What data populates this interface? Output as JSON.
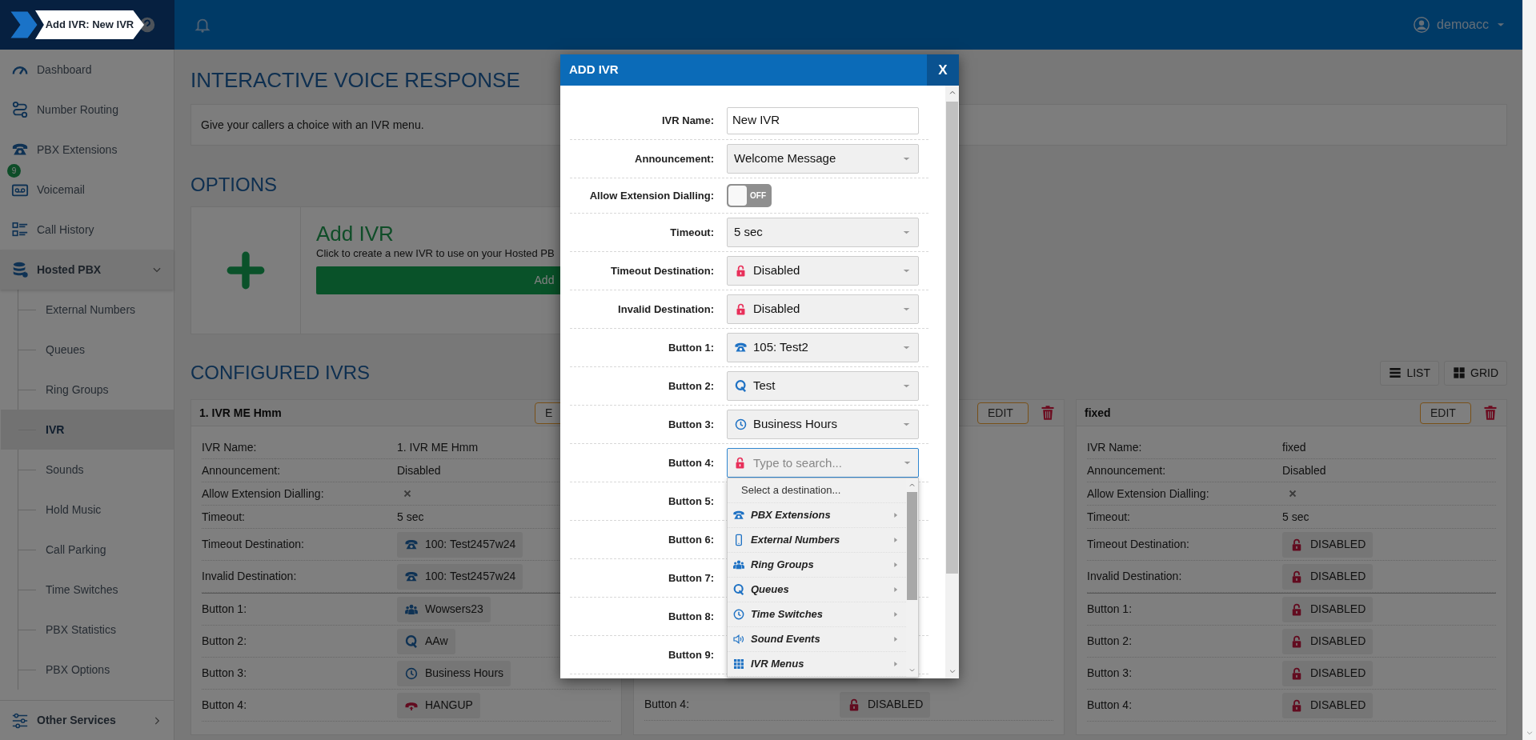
{
  "header": {
    "breadcrumb": "Add IVR: New IVR",
    "user": "demoacc"
  },
  "sidebar": {
    "items": [
      {
        "label": "Dashboard",
        "selected": false
      },
      {
        "label": "Number Routing",
        "selected": false
      },
      {
        "label": "PBX Extensions",
        "selected": false
      },
      {
        "label": "Voicemail",
        "selected": false,
        "badge": "9"
      },
      {
        "label": "Call History",
        "selected": false
      },
      {
        "label": "Hosted PBX",
        "selected": false,
        "expanded": true,
        "children": [
          {
            "label": "External Numbers",
            "selected": false
          },
          {
            "label": "Queues",
            "selected": false
          },
          {
            "label": "Ring Groups",
            "selected": false
          },
          {
            "label": "IVR",
            "selected": true
          },
          {
            "label": "Sounds",
            "selected": false
          },
          {
            "label": "Hold Music",
            "selected": false
          },
          {
            "label": "Call Parking",
            "selected": false
          },
          {
            "label": "Time Switches",
            "selected": false
          },
          {
            "label": "PBX Statistics",
            "selected": false
          },
          {
            "label": "PBX Options",
            "selected": false
          }
        ]
      },
      {
        "label": "Other Services",
        "selected": false,
        "expanded": false
      }
    ]
  },
  "page": {
    "title": "INTERACTIVE VOICE RESPONSE",
    "intro": "Give your callers a choice with an IVR menu.",
    "options_heading": "OPTIONS",
    "option": {
      "title": "Add IVR",
      "description": "Click to create a new IVR to use on your Hosted PB",
      "button": "Add"
    },
    "configured_heading": "CONFIGURED IVRS",
    "view_buttons": [
      "LIST",
      "GRID"
    ]
  },
  "cards": [
    {
      "title": "1. IVR ME Hmm",
      "edit": "E",
      "details": [
        {
          "label": "IVR Name:",
          "kind": "text",
          "value": "1. IVR ME Hmm"
        },
        {
          "label": "Announcement:",
          "kind": "text",
          "value": "Disabled"
        },
        {
          "label": "Allow Extension Dialling:",
          "kind": "bool",
          "checked": false
        },
        {
          "label": "Timeout:",
          "kind": "text",
          "value": "5 sec"
        },
        {
          "label": "Timeout Destination:",
          "kind": "extension",
          "value": "100: Test2457w24"
        },
        {
          "label": "Invalid Destination:",
          "kind": "extension",
          "value": "100: Test2457w24"
        }
      ],
      "buttons": [
        {
          "label": "Button 1:",
          "kind": "ring_group",
          "value": "Wowsers23"
        },
        {
          "label": "Button 2:",
          "kind": "queue",
          "value": "AAw"
        },
        {
          "label": "Button 3:",
          "kind": "time_switch",
          "value": "Business Hours"
        },
        {
          "label": "Button 4:",
          "kind": "hangup",
          "value": "HANGUP"
        }
      ]
    },
    {
      "edit": "EDIT",
      "buttons": [
        {
          "label": "Button 4:",
          "kind": "disabled",
          "value": "DISABLED"
        }
      ]
    },
    {
      "title": "fixed",
      "edit": "EDIT",
      "details": [
        {
          "label": "IVR Name:",
          "kind": "text",
          "value": "fixed"
        },
        {
          "label": "Announcement:",
          "kind": "text",
          "value": "Disabled"
        },
        {
          "label": "Allow Extension Dialling:",
          "kind": "bool",
          "checked": false
        },
        {
          "label": "Timeout:",
          "kind": "text",
          "value": "5 sec"
        },
        {
          "label": "Timeout Destination:",
          "kind": "disabled",
          "value": "DISABLED"
        },
        {
          "label": "Invalid Destination:",
          "kind": "disabled",
          "value": "DISABLED"
        }
      ],
      "buttons": [
        {
          "label": "Button 1:",
          "kind": "disabled",
          "value": "DISABLED"
        },
        {
          "label": "Button 2:",
          "kind": "disabled",
          "value": "DISABLED"
        },
        {
          "label": "Button 3:",
          "kind": "disabled",
          "value": "DISABLED"
        },
        {
          "label": "Button 4:",
          "kind": "disabled",
          "value": "DISABLED"
        }
      ]
    }
  ],
  "modal": {
    "title": "ADD IVR",
    "close": "X",
    "fields": [
      {
        "label": "IVR Name:",
        "kind": "text",
        "value": "New IVR"
      },
      {
        "label": "Announcement:",
        "kind": "select",
        "value": "Welcome Message"
      },
      {
        "label": "Allow Extension Dialling:",
        "kind": "toggle",
        "on": false,
        "text": "OFF"
      },
      {
        "label": "Timeout:",
        "kind": "select",
        "value": "5 sec"
      },
      {
        "label": "Timeout Destination:",
        "kind": "destination",
        "destination": {
          "kind": "disabled",
          "value": "Disabled"
        }
      },
      {
        "label": "Invalid Destination:",
        "kind": "destination",
        "destination": {
          "kind": "disabled",
          "value": "Disabled"
        }
      },
      {
        "label": "Button 1:",
        "kind": "destination",
        "destination": {
          "kind": "extension",
          "value": "105: Test2"
        }
      },
      {
        "label": "Button 2:",
        "kind": "destination",
        "destination": {
          "kind": "queue",
          "value": "Test"
        }
      },
      {
        "label": "Button 3:",
        "kind": "destination",
        "destination": {
          "kind": "time_switch",
          "value": "Business Hours"
        }
      },
      {
        "label": "Button 4:",
        "kind": "search",
        "destination": {
          "kind": "disabled"
        },
        "placeholder": "Type to search...",
        "dropdown": {
          "prompt": "Select a destination...",
          "options": [
            {
              "label": "PBX Extensions",
              "kind": "extension"
            },
            {
              "label": "External Numbers",
              "kind": "external"
            },
            {
              "label": "Ring Groups",
              "kind": "ring_group"
            },
            {
              "label": "Queues",
              "kind": "queue"
            },
            {
              "label": "Time Switches",
              "kind": "time_switch"
            },
            {
              "label": "Sound Events",
              "kind": "sound"
            },
            {
              "label": "IVR Menus",
              "kind": "ivr"
            }
          ]
        }
      },
      {
        "label": "Button 5:",
        "kind": "destination"
      },
      {
        "label": "Button 6:",
        "kind": "destination"
      },
      {
        "label": "Button 7:",
        "kind": "destination"
      },
      {
        "label": "Button 8:",
        "kind": "destination"
      },
      {
        "label": "Button 9:",
        "kind": "destination"
      }
    ]
  }
}
